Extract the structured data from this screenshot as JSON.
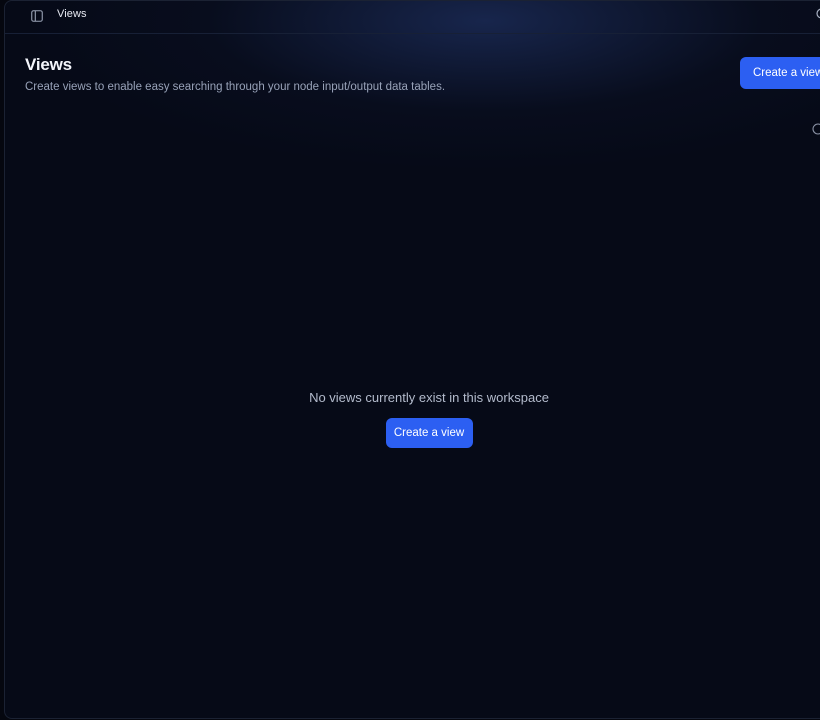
{
  "topbar": {
    "sidebar_icon": "sidebar-toggle-icon",
    "breadcrumb": "Views",
    "right_icon": "search-icon"
  },
  "header": {
    "title": "Views",
    "subtitle": "Create views to enable easy searching through your node input/output data tables.",
    "create_button": "Create a view"
  },
  "toolbar": {
    "right_icon": "refresh-icon"
  },
  "empty_state": {
    "message": "No views currently exist in this workspace",
    "create_button": "Create a view"
  },
  "colors": {
    "background": "#060a17",
    "accent": "#2c5ff2",
    "border": "#1b2233"
  }
}
